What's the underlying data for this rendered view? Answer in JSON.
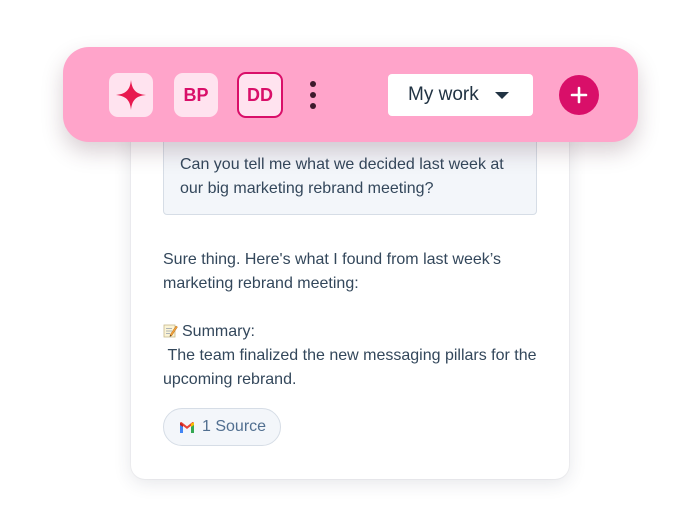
{
  "toolbar": {
    "assistant_icon": "sparkle-icon",
    "avatar_bp": "BP",
    "avatar_dd": "DD",
    "more_icon": "more-vertical-icon",
    "view_select": {
      "selected": "My work"
    },
    "add_icon": "plus-icon",
    "colors": {
      "bar": "#ffa4ca",
      "accent": "#d90f69",
      "tile": "#ffe3ef"
    }
  },
  "chat": {
    "user_message": "Can you tell me what we decided last week at our big marketing rebrand meeting?",
    "reply": {
      "intro": "Sure thing. Here's what I found from last week’s marketing rebrand meeting:",
      "summary_icon": "memo-icon",
      "summary_label": "Summary:",
      "summary_text": " The team finalized the new messaging pillars for the upcoming rebrand."
    },
    "source": {
      "icon": "gmail-icon",
      "label": "1 Source"
    }
  }
}
